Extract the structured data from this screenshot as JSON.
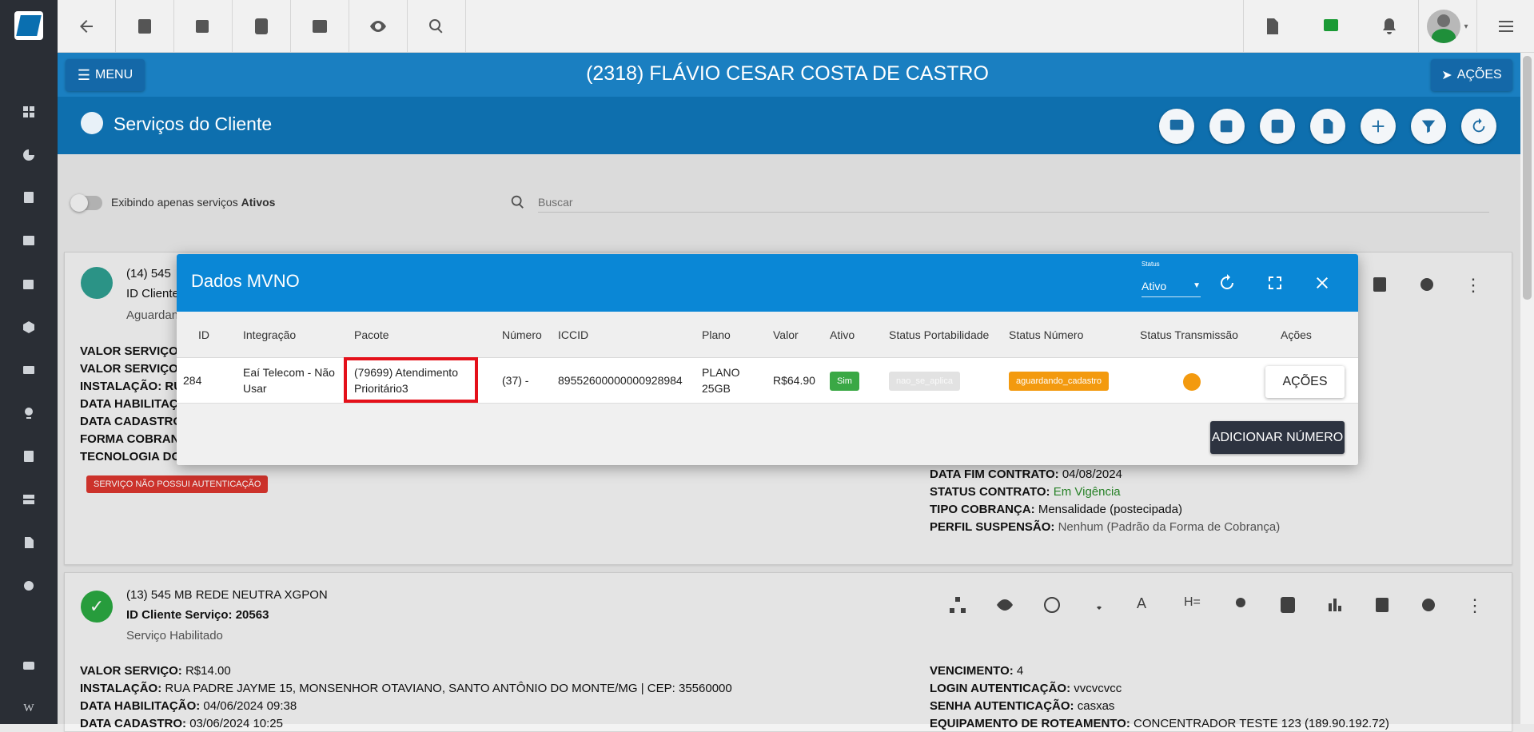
{
  "header": {
    "menu_label": "MENU",
    "client_title": "(2318) FLÁVIO CESAR COSTA DE CASTRO",
    "actions_label": "AÇÕES",
    "section_title": "Serviços do Cliente"
  },
  "filter": {
    "toggle_text": "Exibindo apenas serviços ",
    "toggle_bold": "Ativos",
    "search_placeholder": "Buscar"
  },
  "card1": {
    "title": "(14) 545",
    "id_cliente": "ID Cliente",
    "status": "Aguardan",
    "rows": [
      "VALOR SERVIÇO:",
      "VALOR SERVIÇO",
      "INSTALAÇÃO: RU",
      "DATA HABILITAÇ",
      "DATA CADASTRO",
      "FORMA COBRANÇ",
      "TECNOLOGIA DO"
    ],
    "auth_badge": "SERVIÇO NÃO POSSUI AUTENTICAÇÃO",
    "right": [
      {
        "label": "DATA FIM CONTRATO:",
        "value": "04/08/2024"
      },
      {
        "label": "STATUS CONTRATO:",
        "value": "Em Vigência"
      },
      {
        "label": "TIPO COBRANÇA:",
        "value": "Mensalidade (postecipada)"
      },
      {
        "label": "PERFIL SUSPENSÃO:",
        "value": "Nenhum (Padrão da Forma de Cobrança)"
      }
    ]
  },
  "card2": {
    "title": "(13) 545 MB REDE NEUTRA XGPON",
    "id_cliente": "ID Cliente Serviço: 20563",
    "status": "Serviço Habilitado",
    "left": [
      {
        "label": "VALOR SERVIÇO:",
        "value": "R$14.00"
      },
      {
        "label": "INSTALAÇÃO:",
        "value": "RUA PADRE JAYME 15, MONSENHOR OTAVIANO, SANTO ANTÔNIO DO MONTE/MG | CEP: 35560000"
      },
      {
        "label": "DATA HABILITAÇÃO:",
        "value": "04/06/2024 09:38"
      },
      {
        "label": "DATA CADASTRO:",
        "value": "03/06/2024 10:25"
      }
    ],
    "right": [
      {
        "label": "VENCIMENTO:",
        "value": "4"
      },
      {
        "label": "LOGIN AUTENTICAÇÃO:",
        "value": "vvcvcvcc"
      },
      {
        "label": "SENHA AUTENTICAÇÃO:",
        "value": "casxas"
      },
      {
        "label": "EQUIPAMENTO DE ROTEAMENTO:",
        "value": "CONCENTRADOR TESTE 123 (189.90.192.72)"
      }
    ]
  },
  "modal": {
    "title": "Dados MVNO",
    "status_label": "Status",
    "status_value": "Ativo",
    "columns": [
      "ID",
      "Integração",
      "Pacote",
      "Número",
      "ICCID",
      "Plano",
      "Valor",
      "Ativo",
      "Status Portabilidade",
      "Status Número",
      "Status Transmissão",
      "Ações"
    ],
    "row": {
      "id": "284",
      "integracao_1": "Eaí Telecom - Não",
      "integracao_2": "Usar",
      "pacote_1": "(79699) Atendimento",
      "pacote_2": "Prioritário3",
      "numero": "(37) -",
      "iccid": "89552600000000928984",
      "plano_1": "PLANO",
      "plano_2": "25GB",
      "valor": "R$64.90",
      "ativo": "Sim",
      "status_portabilidade": "nao_se_aplica",
      "status_numero": "aguardando_cadastro",
      "acoes_label": "AÇÕES"
    },
    "add_button": "ADICIONAR NÚMERO"
  },
  "colors": {
    "brand_blue": "#1a7fc1",
    "modal_blue": "#0a87d6",
    "badge_green": "#3aa845",
    "badge_orange": "#f39a0f",
    "badge_red": "#d9362e",
    "highlight_red": "#e4101a"
  }
}
